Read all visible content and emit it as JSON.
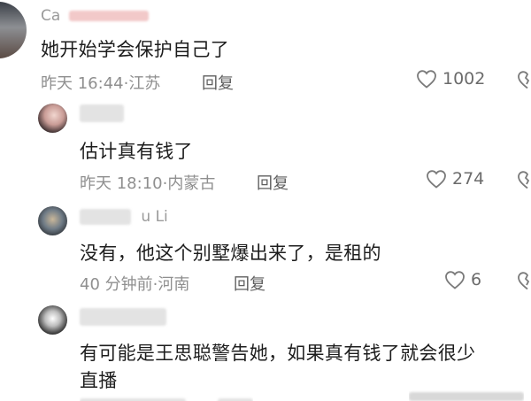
{
  "comments": [
    {
      "username": "Ca",
      "text": "她开始学会保护自己了",
      "time": "昨天 16:44",
      "location": "江苏",
      "reply_label": "回复",
      "likes": "1002"
    },
    {
      "username": "",
      "text": "估计真有钱了",
      "time": "昨天 18:10",
      "location": "内蒙古",
      "reply_label": "回复",
      "likes": "274"
    },
    {
      "username": "u Li",
      "text": "没有，他这个别墅爆出来了，是租的",
      "time": "40 分钟前",
      "location": "河南",
      "reply_label": "回复",
      "likes": "6"
    },
    {
      "username": "",
      "text_line1": "有可能是王思聪警告她，如果真有钱了就会很少",
      "text_line2": "直播",
      "time": "",
      "location": "",
      "reply_label": "",
      "likes": ""
    }
  ],
  "meta_separator": "·",
  "icons": {
    "like": "heart-outline-icon",
    "dislike": "broken-heart-icon"
  },
  "colors": {
    "text": "#1d1d1d",
    "meta": "#8f8f8f",
    "reply": "#5f5f5f",
    "icon": "#7a7a7a"
  }
}
